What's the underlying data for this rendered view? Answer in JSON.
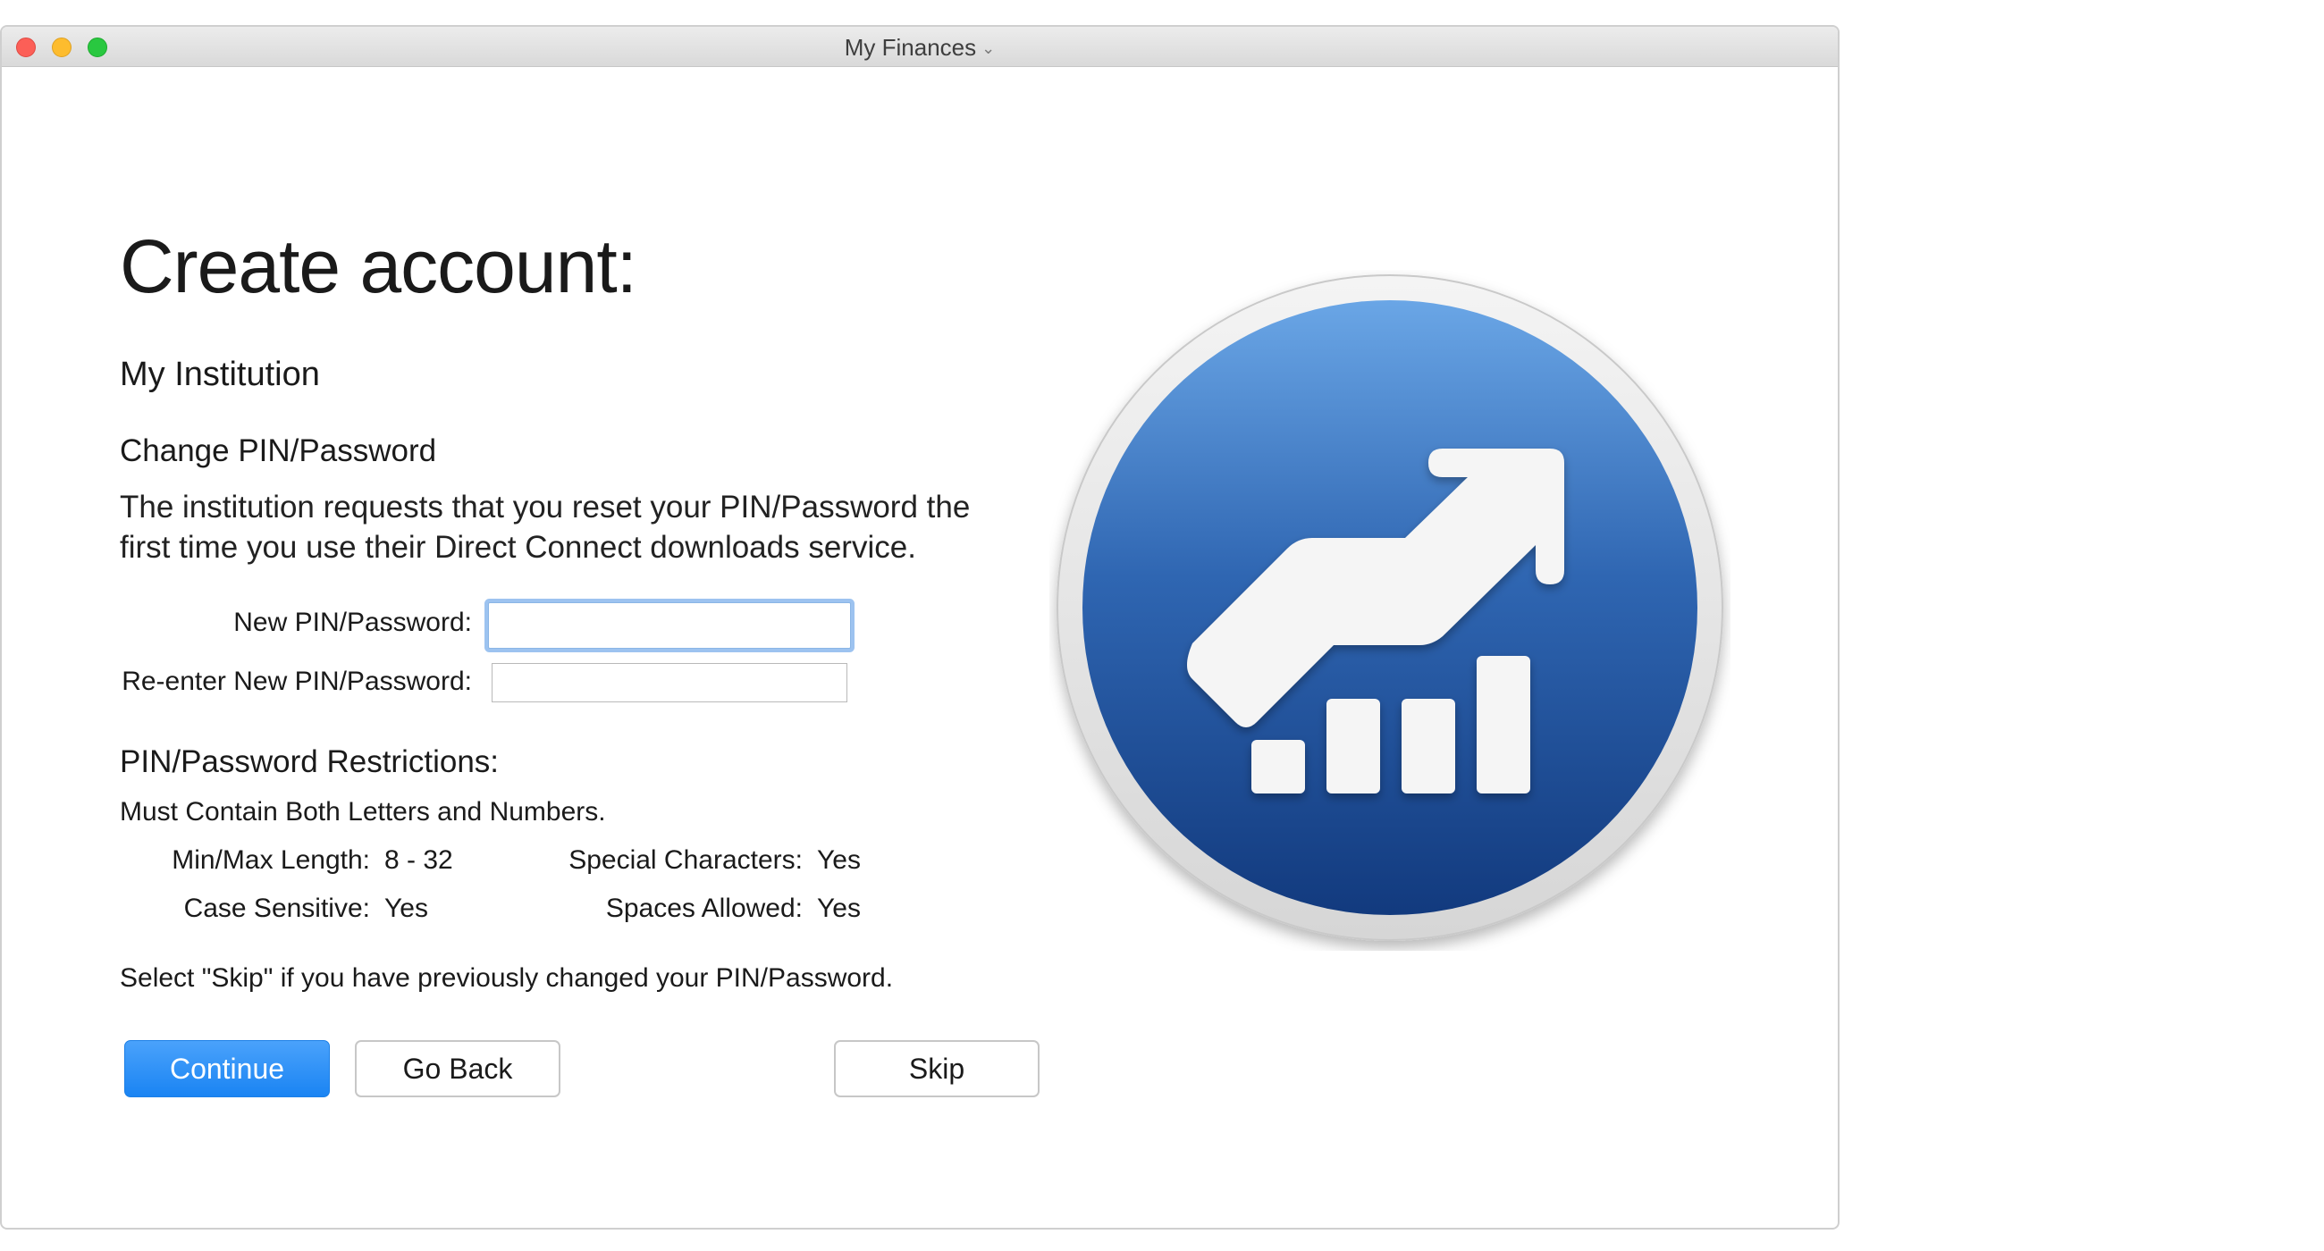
{
  "window": {
    "title": "My Finances"
  },
  "page": {
    "heading": "Create account:",
    "institution": "My Institution",
    "section_title": "Change PIN/Password",
    "description": "The institution requests that you reset your PIN/Password the first time you use their Direct Connect downloads service."
  },
  "form": {
    "new_label": "New PIN/Password:",
    "new_value": "",
    "reenter_label": "Re-enter New PIN/Password:",
    "reenter_value": ""
  },
  "restrictions": {
    "title": "PIN/Password Restrictions:",
    "subtitle": "Must Contain Both Letters and Numbers.",
    "items": [
      {
        "key": "Min/Max Length:",
        "value": "8 - 32"
      },
      {
        "key": "Special Characters:",
        "value": "Yes"
      },
      {
        "key": "Case Sensitive:",
        "value": "Yes"
      },
      {
        "key": "Spaces Allowed:",
        "value": "Yes"
      }
    ]
  },
  "note": "Select \"Skip\" if you have previously changed your PIN/Password.",
  "buttons": {
    "continue": "Continue",
    "go_back": "Go Back",
    "skip": "Skip"
  },
  "icons": {
    "app_icon": "finance-growth-icon",
    "title_chevron": "chevron-down-icon"
  },
  "colors": {
    "accent": "#1a84f3",
    "icon_blue_top": "#6aa6e6",
    "icon_blue_bottom": "#123a7e"
  }
}
